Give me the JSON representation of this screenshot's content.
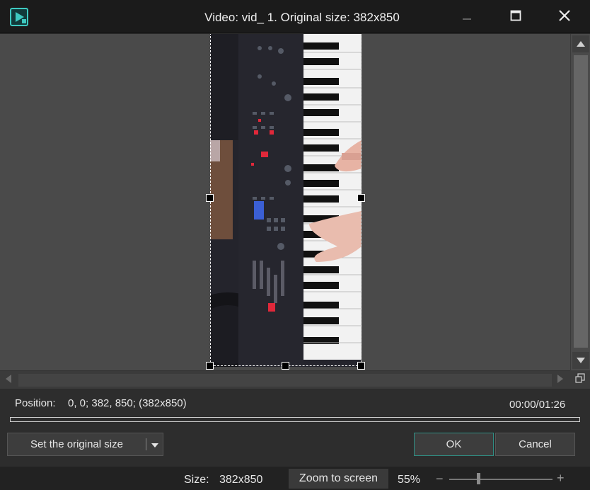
{
  "window": {
    "title": "Video: vid_ 1. Original size: 382x850",
    "icon": "app-video-icon",
    "controls": {
      "minimize": "minimize-icon",
      "maximize": "maximize-icon",
      "close": "close-icon"
    }
  },
  "position": {
    "label": "Position:",
    "value": "0, 0; 382, 850; (382x850)",
    "timecode": "00:00/01:26",
    "progress": 0
  },
  "buttons": {
    "set_original": "Set the original size",
    "dropdown_icon": "caret-down-icon",
    "ok": "OK",
    "cancel": "Cancel"
  },
  "status": {
    "size_label": "Size:",
    "size_value": "382x850",
    "zoom_button": "Zoom to screen",
    "zoom_value": "55%",
    "zoom_minus": "−",
    "zoom_plus": "+",
    "zoom_level": 0.28
  },
  "colors": {
    "accent": "#2f8f84",
    "icon_teal": "#3ec9c0"
  }
}
